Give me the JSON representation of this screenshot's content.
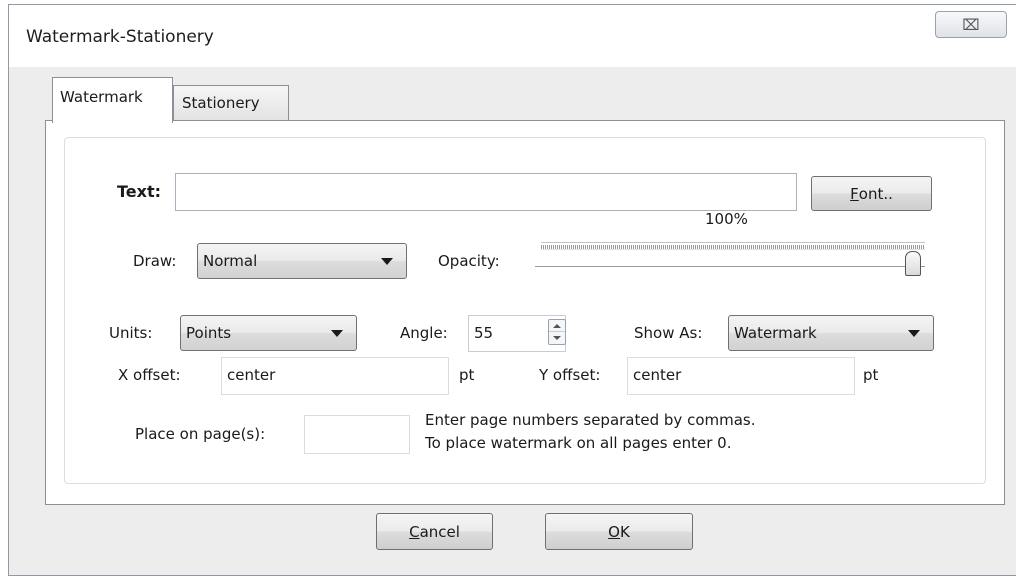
{
  "window": {
    "title": "Watermark-Stationery",
    "close_icon": "⌧"
  },
  "tabs": [
    {
      "label": "Watermark",
      "active": true
    },
    {
      "label": "Stationery",
      "active": false
    }
  ],
  "watermark": {
    "text_label": "Text:",
    "text_value": "",
    "font_button": {
      "mnemonic": "F",
      "rest": "ont.."
    },
    "draw_label": "Draw:",
    "draw_value": "Normal",
    "opacity_label": "Opacity:",
    "opacity_value_text": "100%",
    "opacity_percent": 100,
    "units_label": "Units:",
    "units_value": "Points",
    "angle_label": "Angle:",
    "angle_value": "55",
    "show_as_label": "Show As:",
    "show_as_value": "Watermark",
    "x_offset_label": "X offset:",
    "x_offset_value": "center",
    "x_offset_unit": "pt",
    "y_offset_label": "Y offset:",
    "y_offset_value": "center",
    "y_offset_unit": "pt",
    "place_label": "Place on page(s):",
    "place_value": "",
    "hint_line1": "Enter page numbers separated by commas.",
    "hint_line2": "To place watermark on all pages enter 0."
  },
  "footer": {
    "cancel": {
      "mnemonic": "C",
      "rest": "ancel"
    },
    "ok": {
      "mnemonic": "O",
      "rest": "K"
    }
  }
}
